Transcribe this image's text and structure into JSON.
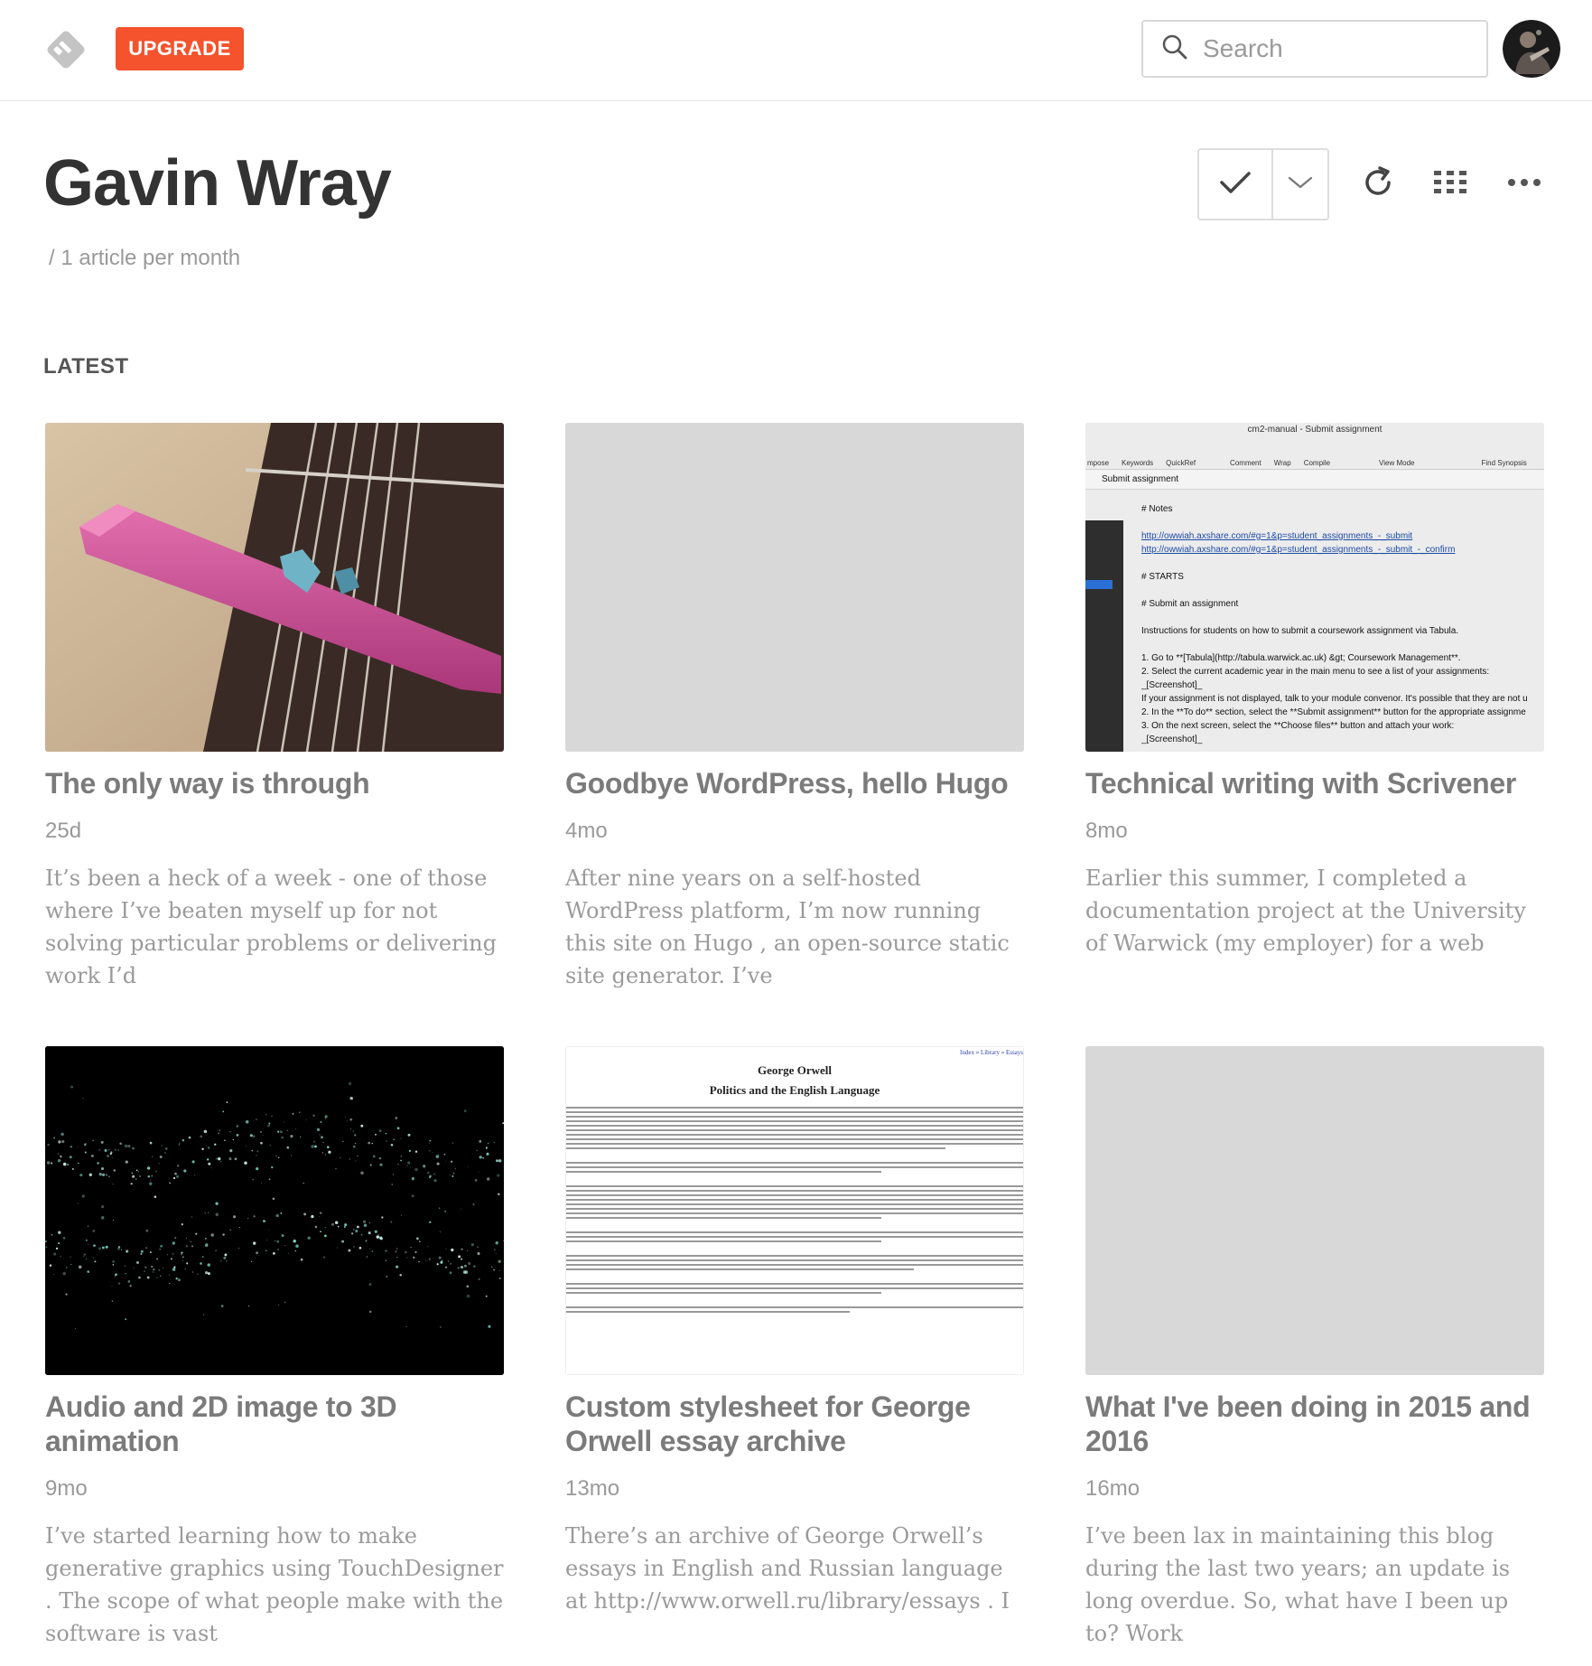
{
  "app": {
    "upgrade_label": "UPGRADE",
    "search_placeholder": "Search",
    "colors": {
      "accent": "#f5532d",
      "title": "#333333",
      "muted": "#999999"
    },
    "icons": [
      "feedly-logo-icon",
      "search-icon",
      "avatar",
      "check-icon",
      "chevron-down-icon",
      "refresh-icon",
      "grid-view-icon",
      "more-icon"
    ]
  },
  "header": {
    "title": "Gavin Wray",
    "subtitle": "/ 1 article per month",
    "section": "LATEST"
  },
  "articles": [
    {
      "title": "The only way is through",
      "time": "25d",
      "excerpt": "It’s been a heck of a week - one of those where I’ve beaten myself up for not solving particular problems or delivering work I’d"
    },
    {
      "title": "Goodbye WordPress, hello Hugo",
      "time": "4mo",
      "excerpt": "After nine years on a self-hosted WordPress platform, I’m now running this site on Hugo , an open-source static site generator. I’ve"
    },
    {
      "title": "Technical writing with Scrivener",
      "time": "8mo",
      "excerpt": "Earlier this summer, I completed a documentation project at the University of Warwick (my employer) for a web"
    },
    {
      "title": "Audio and 2D image to 3D animation",
      "time": "9mo",
      "excerpt": "I’ve started learning how to make generative graphics using TouchDesigner . The scope of what people make with the software is vast"
    },
    {
      "title": "Custom stylesheet for George Orwell essay archive",
      "time": "13mo",
      "excerpt": "There’s an archive of George Orwell’s essays in English and Russian language at http://www.orwell.ru/library/essays . I"
    },
    {
      "title": "What I've been doing in 2015 and 2016",
      "time": "16mo",
      "excerpt": "I’ve been lax in maintaining this blog during the last two years; an update is long overdue. So, what have I been up to? Work"
    }
  ],
  "scrivener_thumb": {
    "window_title": "cm2-manual - Submit assignment",
    "toolbar": [
      "mpose",
      "Keywords",
      "QuickRef",
      "Comment",
      "Wrap",
      "Compile",
      "View Mode",
      "Find Synopsis"
    ],
    "nav": "Submit assignment",
    "lines": [
      "# Notes",
      "",
      "http://owwiah.axshare.com/#g=1&p=student_assignments_-_submit",
      "http://owwiah.axshare.com/#g=1&p=student_assignments_-_submit_-_confirm",
      "",
      "# STARTS",
      "",
      "# Submit an assignment",
      "",
      "Instructions for students on how to submit a coursework assignment via Tabula.",
      "",
      "1. Go to **[Tabula](http://tabula.warwick.ac.uk) &gt; Coursework Management**.",
      "2. Select the current academic year in the main menu to see a list of your assignments:",
      "_[Screenshot]_",
      "If your assignment is not displayed, talk to your module convenor. It's possible that they are not u",
      "2. In the **To do** section, select the **Submit assignment** button for the appropriate assignme",
      "3. On the next screen, select the **Choose files** button and attach your work:",
      "_[Screenshot]_"
    ]
  },
  "orwell_thumb": {
    "crumbs": "Index » Library » Essays",
    "author": "George Orwell",
    "title": "Politics and the English Language"
  }
}
